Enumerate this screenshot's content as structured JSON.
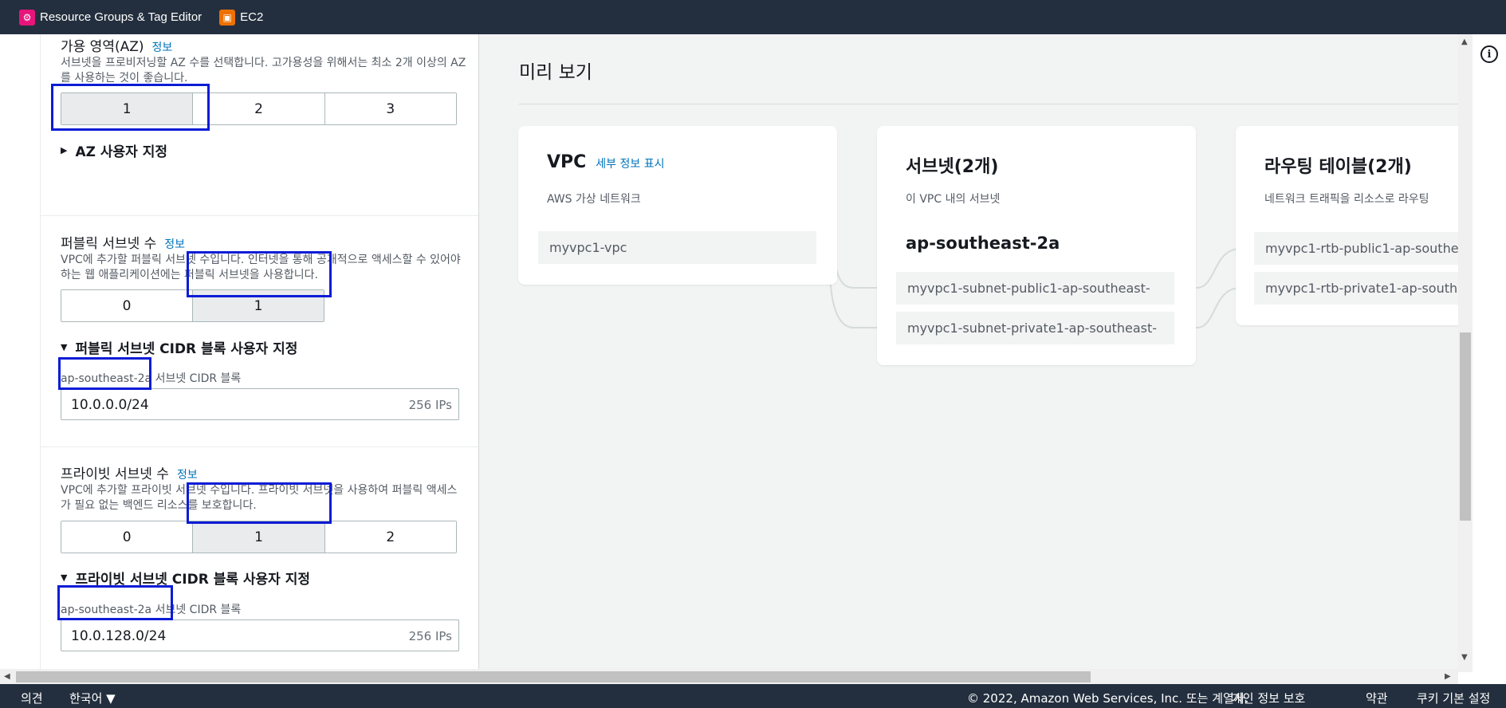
{
  "topbar": {
    "favorites": [
      {
        "label": "Resource Groups & Tag Editor",
        "icon": "resource-groups-icon"
      },
      {
        "label": "EC2",
        "icon": "ec2-icon"
      }
    ]
  },
  "form": {
    "az": {
      "label": "가용 영역(AZ)",
      "info": "정보",
      "description": "서브넷을 프로비저닝할 AZ 수를 선택합니다. 고가용성을 위해서는 최소 2개 이상의 AZ를 사용하는 것이 좋습니다.",
      "options": [
        "1",
        "2",
        "3"
      ],
      "selected": "1",
      "customize": "AZ 사용자 지정"
    },
    "public_subnets": {
      "label": "퍼블릭 서브넷 수",
      "info": "정보",
      "description": "VPC에 추가할 퍼블릭 서브넷 수입니다. 인터넷을 통해 공개적으로 액세스할 수 있어야 하는 웹 애플리케이션에는 퍼블릭 서브넷을 사용합니다.",
      "options": [
        "0",
        "1"
      ],
      "selected": "1",
      "customize": "퍼블릭 서브넷 CIDR 블록 사용자 지정",
      "cidr_label": "ap-southeast-2a 서브넷 CIDR 블록",
      "cidr_value": "10.0.0.0/24",
      "cidr_ips": "256 IPs"
    },
    "private_subnets": {
      "label": "프라이빗 서브넷 수",
      "info": "정보",
      "description": "VPC에 추가할 프라이빗 서브넷 수입니다. 프라이빗 서브넷을 사용하여 퍼블릭 액세스가 필요 없는 백엔드 리소스를 보호합니다.",
      "options": [
        "0",
        "1",
        "2"
      ],
      "selected": "1",
      "customize": "프라이빗 서브넷 CIDR 블록 사용자 지정",
      "cidr_label": "ap-southeast-2a 서브넷 CIDR 블록",
      "cidr_value": "10.0.128.0/24",
      "cidr_ips": "256 IPs"
    }
  },
  "preview": {
    "title": "미리 보기",
    "vpc": {
      "title": "VPC",
      "link": "세부 정보 표시",
      "subtitle": "AWS 가상 네트워크",
      "name": "myvpc1-vpc"
    },
    "subnets": {
      "title": "서브넷(2개)",
      "subtitle": "이 VPC 내의 서브넷",
      "az": "ap-southeast-2a",
      "items": [
        "myvpc1-subnet-public1-ap-southeast-",
        "myvpc1-subnet-private1-ap-southeast-"
      ]
    },
    "route_tables": {
      "title": "라우팅 테이블(2개)",
      "subtitle": "네트워크 트래픽을 리소스로 라우팅",
      "items": [
        "myvpc1-rtb-public1-ap-southe",
        "myvpc1-rtb-private1-ap-south"
      ]
    }
  },
  "footer": {
    "feedback": "의견",
    "language": "한국어 ▼",
    "copyright": "© 2022, Amazon Web Services, Inc. 또는 계열사.",
    "privacy": "개인 정보 보호",
    "terms": "약관",
    "cookies": "쿠키 기본 설정"
  },
  "colors": {
    "nav_bg": "#232f3e",
    "link": "#0073bb",
    "highlight": "#0a1cd6",
    "selected_segment": "#e9ebed"
  }
}
